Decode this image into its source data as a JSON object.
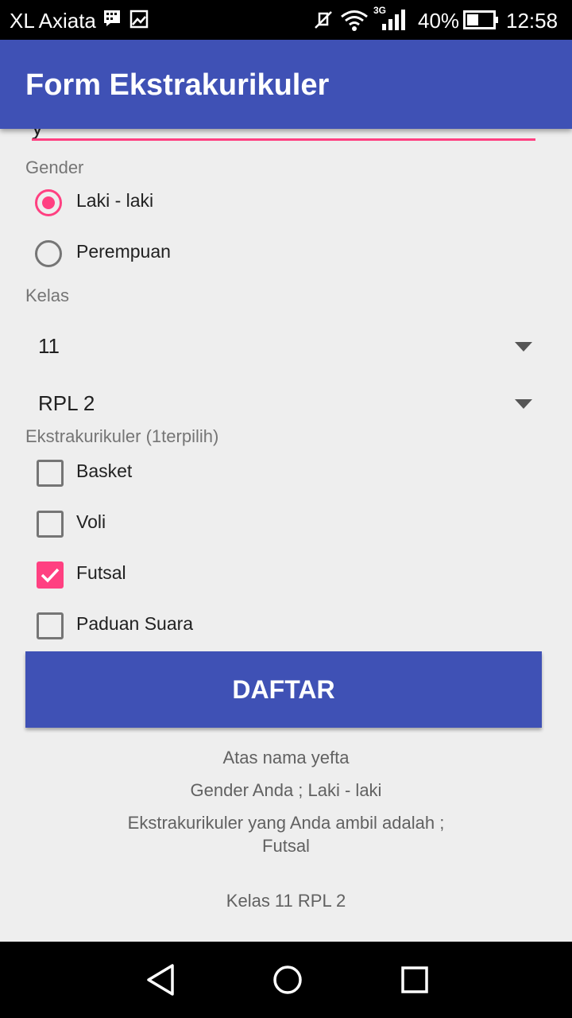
{
  "status_bar": {
    "carrier": "XL Axiata",
    "network_type": "3G",
    "battery": "40%",
    "time": "12:58",
    "icons": [
      "bbm-icon",
      "image-icon",
      "mute-icon",
      "wifi-icon",
      "signal-icon",
      "battery-icon"
    ]
  },
  "app_bar": {
    "title": "Form Ekstrakurikuler"
  },
  "name_field": {
    "value": "y"
  },
  "gender": {
    "label": "Gender",
    "options": [
      {
        "label": "Laki - laki",
        "checked": true
      },
      {
        "label": "Perempuan",
        "checked": false
      }
    ]
  },
  "kelas": {
    "label": "Kelas",
    "grade_selected": "11",
    "major_selected": "RPL 2"
  },
  "ekskul": {
    "label": "Ekstrakurikuler (1terpilih)",
    "options": [
      {
        "label": "Basket",
        "checked": false
      },
      {
        "label": "Voli",
        "checked": false
      },
      {
        "label": "Futsal",
        "checked": true
      },
      {
        "label": "Paduan Suara",
        "checked": false
      }
    ]
  },
  "submit_button": {
    "label": "DAFTAR"
  },
  "result": {
    "name_line": "Atas nama yefta",
    "gender_line": "Gender Anda ; Laki - laki",
    "ekskul_line": "Ekstrakurikuler yang Anda ambil adalah ;\nFutsal",
    "kelas_line": "Kelas 11  RPL 2"
  },
  "colors": {
    "primary": "#3f51b5",
    "accent": "#ff4081",
    "background": "#eeeeee"
  }
}
